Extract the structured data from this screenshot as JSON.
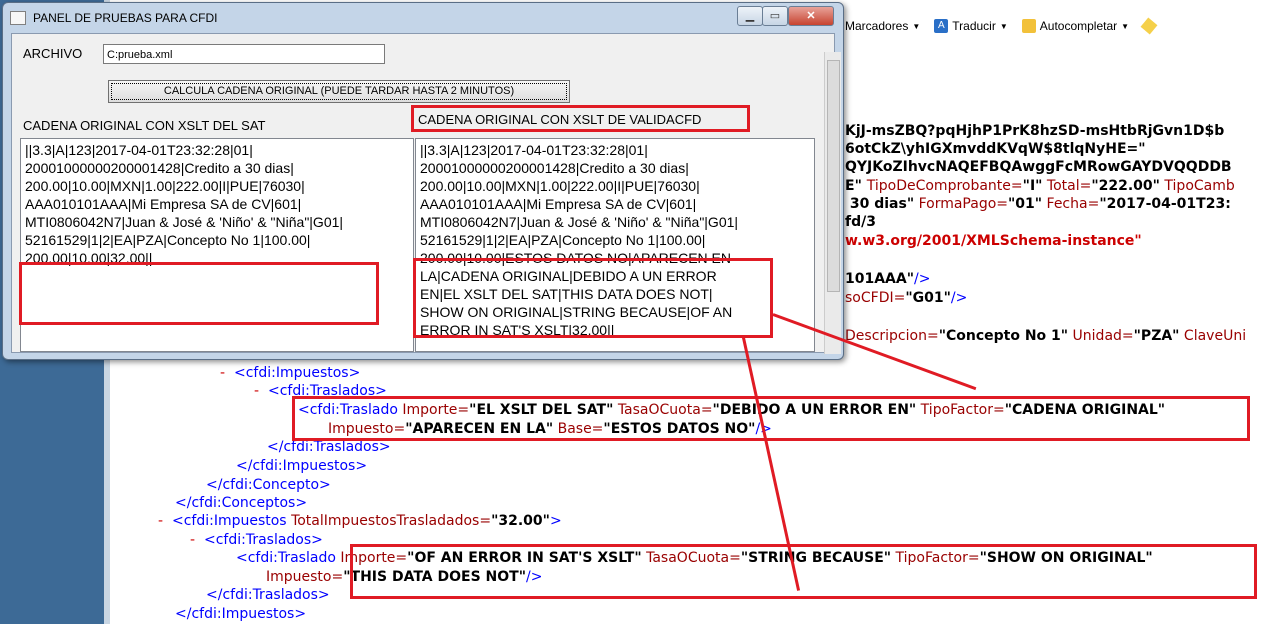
{
  "dialog": {
    "title": "PANEL DE PRUEBAS PARA CFDI",
    "archivo_label": "ARCHIVO",
    "archivo_value": "C:prueba.xml",
    "calc_button": "CALCULA CADENA ORIGINAL (PUEDE TARDAR HASTA 2 MINUTOS)",
    "label_sat": "CADENA ORIGINAL CON XSLT DEL SAT",
    "label_validacfd": "CADENA ORIGINAL CON XSLT DE VALIDACFD",
    "text_sat": [
      "||3.3|A|123|2017-04-01T23:32:28|01|",
      "20001000000200001428|Credito a 30 dias|",
      "200.00|10.00|MXN|1.00|222.00|I|PUE|76030|",
      "AAA010101AAA|Mi Empresa SA de CV|601|",
      "MTI0806042N7|Juan & José & 'Niño' & \"Niña\"|G01|",
      "52161529|1|2|EA|PZA|Concepto No 1|100.00|",
      "200.00|10.00|32.00||"
    ],
    "text_validacfd": [
      "||3.3|A|123|2017-04-01T23:32:28|01|",
      "20001000000200001428|Credito a 30 dias|",
      "200.00|10.00|MXN|1.00|222.00|I|PUE|76030|",
      "AAA010101AAA|Mi Empresa SA de CV|601|",
      "MTI0806042N7|Juan & José & 'Niño' & \"Niña\"|G01|",
      "52161529|1|2|EA|PZA|Concepto No 1|100.00|",
      "200.00|10.00|ESTOS DATOS NO|APARECEN EN",
      "LA|CADENA ORIGINAL|DEBIDO A UN ERROR",
      "EN|EL XSLT DEL SAT|THIS DATA DOES NOT|",
      "SHOW ON ORIGINAL|STRING BECAUSE|OF AN",
      "ERROR IN SAT'S XSLT|32.00||"
    ],
    "window_buttons": {
      "minimize": "▁",
      "maximize": "▭",
      "close": "✕"
    }
  },
  "browser_toolbar": {
    "bookmarks": "Marcadores",
    "translate": "Traducir",
    "autocomplete": "Autocompletar"
  },
  "xml_right": {
    "l1": "KjJ-msZBQ?pqHjhP1PrK8hzSD-msHtbRjGvn1D$b",
    "l2": "6otCkZ\\yhIGXmvddKVqW$8tlqNyHE=\"",
    "l3": "QYJKoZIhvcNAQEFBQAwggFcMRowGAYDVQQDDB",
    "l4_a": "E\" ",
    "l4_b": "TipoDeComprobante=",
    "l4_c": "\"I\"",
    "l4_d": " Total=",
    "l4_e": "\"222.00\"",
    "l4_f": " TipoCamb",
    "l5_a": " 30 dias\"",
    "l5_b": " FormaPago=",
    "l5_c": "\"01\"",
    "l5_d": " Fecha=",
    "l5_e": "\"2017-04-01T23:",
    "l6": "fd/3",
    "l7": "w.w3.org/2001/XMLSchema-instance\"",
    "l8_a": "101AAA\"",
    "l8_b": "/>",
    "l9_a": "soCFDI=",
    "l9_b": "\"G01\"",
    "l9_c": "/>",
    "l10_a": "Descripcion=",
    "l10_b": "\"Concepto No 1\"",
    "l10_c": " Unidad=",
    "l10_d": "\"PZA\"",
    "l10_e": " ClaveUni"
  },
  "xml": {
    "impuestos_open": "<cfdi:Impuestos>",
    "traslados_open": "<cfdi:Traslados>",
    "traslado1_a": "<cfdi:Traslado ",
    "traslado1_b": "Importe=",
    "traslado1_c": "\"EL XSLT DEL SAT\"",
    "traslado1_d": " TasaOCuota=",
    "traslado1_e": "\"DEBIDO A UN ERROR EN\"",
    "traslado1_f": " TipoFactor=",
    "traslado1_g": "\"CADENA ORIGINAL\"",
    "traslado1_h": "Impuesto=",
    "traslado1_i": "\"APARECEN EN LA\"",
    "traslado1_j": " Base=",
    "traslado1_k": "\"ESTOS DATOS NO\"",
    "traslado1_l": "/>",
    "traslados_close": "</cfdi:Traslados>",
    "impuestos_close": "</cfdi:Impuestos>",
    "concepto_close": "</cfdi:Concepto>",
    "conceptos_close": "</cfdi:Conceptos>",
    "impuestos2_a": "<cfdi:Impuestos ",
    "impuestos2_b": "TotalImpuestosTrasladados=",
    "impuestos2_c": "\"32.00\"",
    "impuestos2_d": ">",
    "traslados2_open": "<cfdi:Traslados>",
    "traslado2_a": "<cfdi:Traslado ",
    "traslado2_b": "Importe=",
    "traslado2_c": "\"OF AN ERROR IN SAT'S XSLT\"",
    "traslado2_d": " TasaOCuota=",
    "traslado2_e": "\"STRING BECAUSE\"",
    "traslado2_f": " TipoFactor=",
    "traslado2_g": "\"SHOW ON ORIGINAL\"",
    "traslado2_h": "Impuesto=",
    "traslado2_i": "\"THIS DATA DOES NOT\"",
    "traslado2_j": "/>",
    "traslados2_close": "</cfdi:Traslados>",
    "impuestos2_close": "</cfdi:Impuestos>",
    "minus": "-"
  },
  "colors": {
    "annotation_red": "#e01b24",
    "tag": "#990000",
    "bracket": "#0000ff"
  }
}
